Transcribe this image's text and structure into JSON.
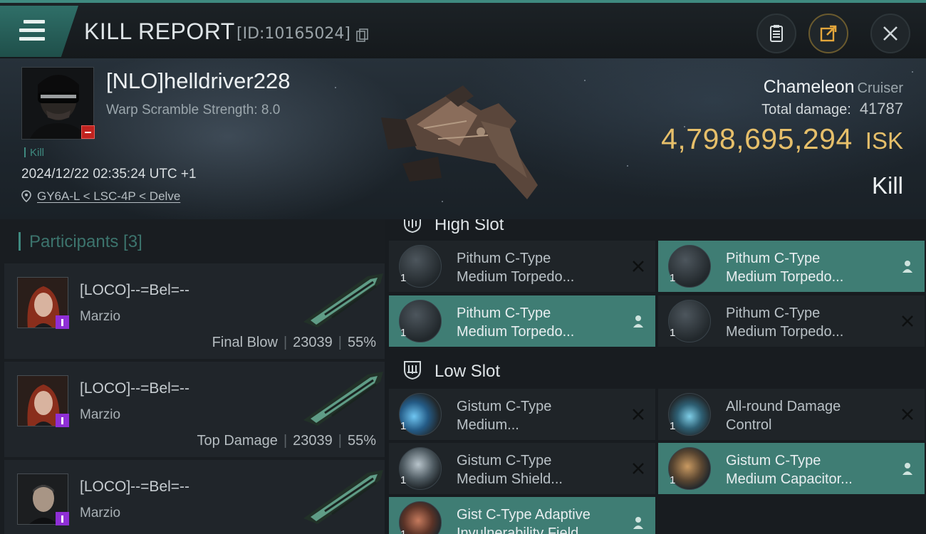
{
  "header": {
    "title": "KILL REPORT",
    "report_id": "[ID:10165024]"
  },
  "victim": {
    "name": "[NLO]helldriver228",
    "warp_scramble": "Warp Scramble Strength: 8.0",
    "kill_tag": "Kill",
    "datetime": "2024/12/22 02:35:24 UTC +1",
    "location": "GY6A-L < LSC-4P < Delve",
    "ship_name": "Chameleon",
    "ship_class": "Cruiser",
    "total_damage_label": "Total damage:",
    "total_damage": "41787",
    "isk_value": "4,798,695,294",
    "isk_unit": "ISK",
    "result": "Kill"
  },
  "participants": {
    "header": "Participants [3]",
    "list": [
      {
        "name": "[LOCO]--=Bel=--",
        "ship": "Marzio",
        "role": "Final Blow",
        "damage": "23039",
        "percent": "55%"
      },
      {
        "name": "[LOCO]--=Bel=--",
        "ship": "Marzio",
        "role": "Top Damage",
        "damage": "23039",
        "percent": "55%"
      },
      {
        "name": "[LOCO]--=Bel=--",
        "ship": "Marzio",
        "role": "",
        "damage": "",
        "percent": ""
      }
    ]
  },
  "fitting": {
    "high_slot_title": "High Slot",
    "low_slot_title": "Low Slot",
    "high_slots": [
      {
        "line1": "Pithum C-Type",
        "line2": "Medium Torpedo...",
        "qty": "1",
        "state": "destroyed"
      },
      {
        "line1": "Pithum C-Type",
        "line2": "Medium Torpedo...",
        "qty": "1",
        "state": "dropped"
      },
      {
        "line1": "Pithum C-Type",
        "line2": "Medium Torpedo...",
        "qty": "1",
        "state": "dropped"
      },
      {
        "line1": "Pithum C-Type",
        "line2": "Medium Torpedo...",
        "qty": "1",
        "state": "destroyed"
      }
    ],
    "low_slots": [
      {
        "line1": "Gistum C-Type",
        "line2": "Medium...",
        "qty": "1",
        "state": "destroyed"
      },
      {
        "line1": "All-round Damage",
        "line2": "Control",
        "qty": "1",
        "state": "destroyed"
      },
      {
        "line1": "Gistum C-Type",
        "line2": "Medium Shield...",
        "qty": "1",
        "state": "destroyed"
      },
      {
        "line1": "Gistum C-Type",
        "line2": "Medium Capacitor...",
        "qty": "1",
        "state": "dropped"
      },
      {
        "line1": "Gist C-Type Adaptive",
        "line2": "Invulnerability Field",
        "qty": "1",
        "state": "dropped"
      }
    ]
  },
  "colors": {
    "accent": "#3f7d74",
    "isk": "#e6bf6a",
    "security_status": "#c0231f",
    "corp_badge": "#8f2fd6"
  },
  "icons": {
    "menu": "hamburger-icon",
    "copy": "copy-icon",
    "clipboard": "clipboard-icon",
    "share": "share-icon",
    "close": "close-icon",
    "location": "location-pin-icon",
    "dropped": "person-icon",
    "destroyed": "x-icon"
  }
}
